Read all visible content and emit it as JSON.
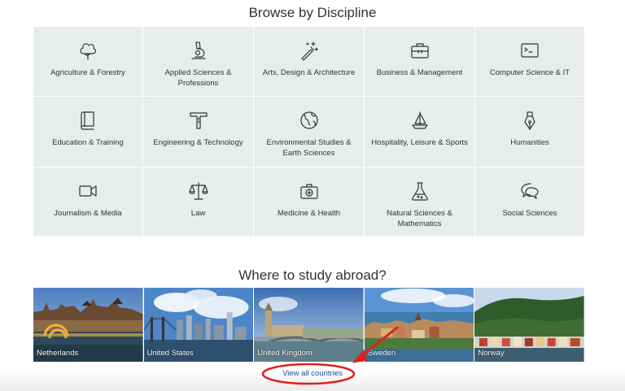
{
  "browse": {
    "title": "Browse by Discipline",
    "items": [
      {
        "label": "Agriculture & Forestry",
        "icon": "tree-icon"
      },
      {
        "label": "Applied Sciences & Professions",
        "icon": "microscope-icon"
      },
      {
        "label": "Arts, Design & Architecture",
        "icon": "magic-wand-icon"
      },
      {
        "label": "Business & Management",
        "icon": "briefcase-icon"
      },
      {
        "label": "Computer Science & IT",
        "icon": "terminal-icon"
      },
      {
        "label": "Education & Training",
        "icon": "book-icon"
      },
      {
        "label": "Engineering & Technology",
        "icon": "t-square-icon"
      },
      {
        "label": "Environmental Studies & Earth Sciences",
        "icon": "globe-icon"
      },
      {
        "label": "Hospitality, Leisure & Sports",
        "icon": "sailboat-icon"
      },
      {
        "label": "Humanities",
        "icon": "fountain-pen-icon"
      },
      {
        "label": "Journalism & Media",
        "icon": "video-camera-icon"
      },
      {
        "label": "Law",
        "icon": "scales-icon"
      },
      {
        "label": "Medicine & Health",
        "icon": "medical-kit-icon"
      },
      {
        "label": "Natural Sciences & Mathematics",
        "icon": "flask-icon"
      },
      {
        "label": "Social Sciences",
        "icon": "speech-bubbles-icon"
      }
    ]
  },
  "study": {
    "title": "Where to study abroad?",
    "countries": [
      {
        "name": "Netherlands"
      },
      {
        "name": "United States"
      },
      {
        "name": "United Kingdom"
      },
      {
        "name": "Sweden"
      },
      {
        "name": "Norway"
      }
    ],
    "view_all_label": "View all countries"
  },
  "colors": {
    "tile_bg": "#e8ecec",
    "link": "#1f4fa3",
    "annotation_red": "#e0201b"
  }
}
